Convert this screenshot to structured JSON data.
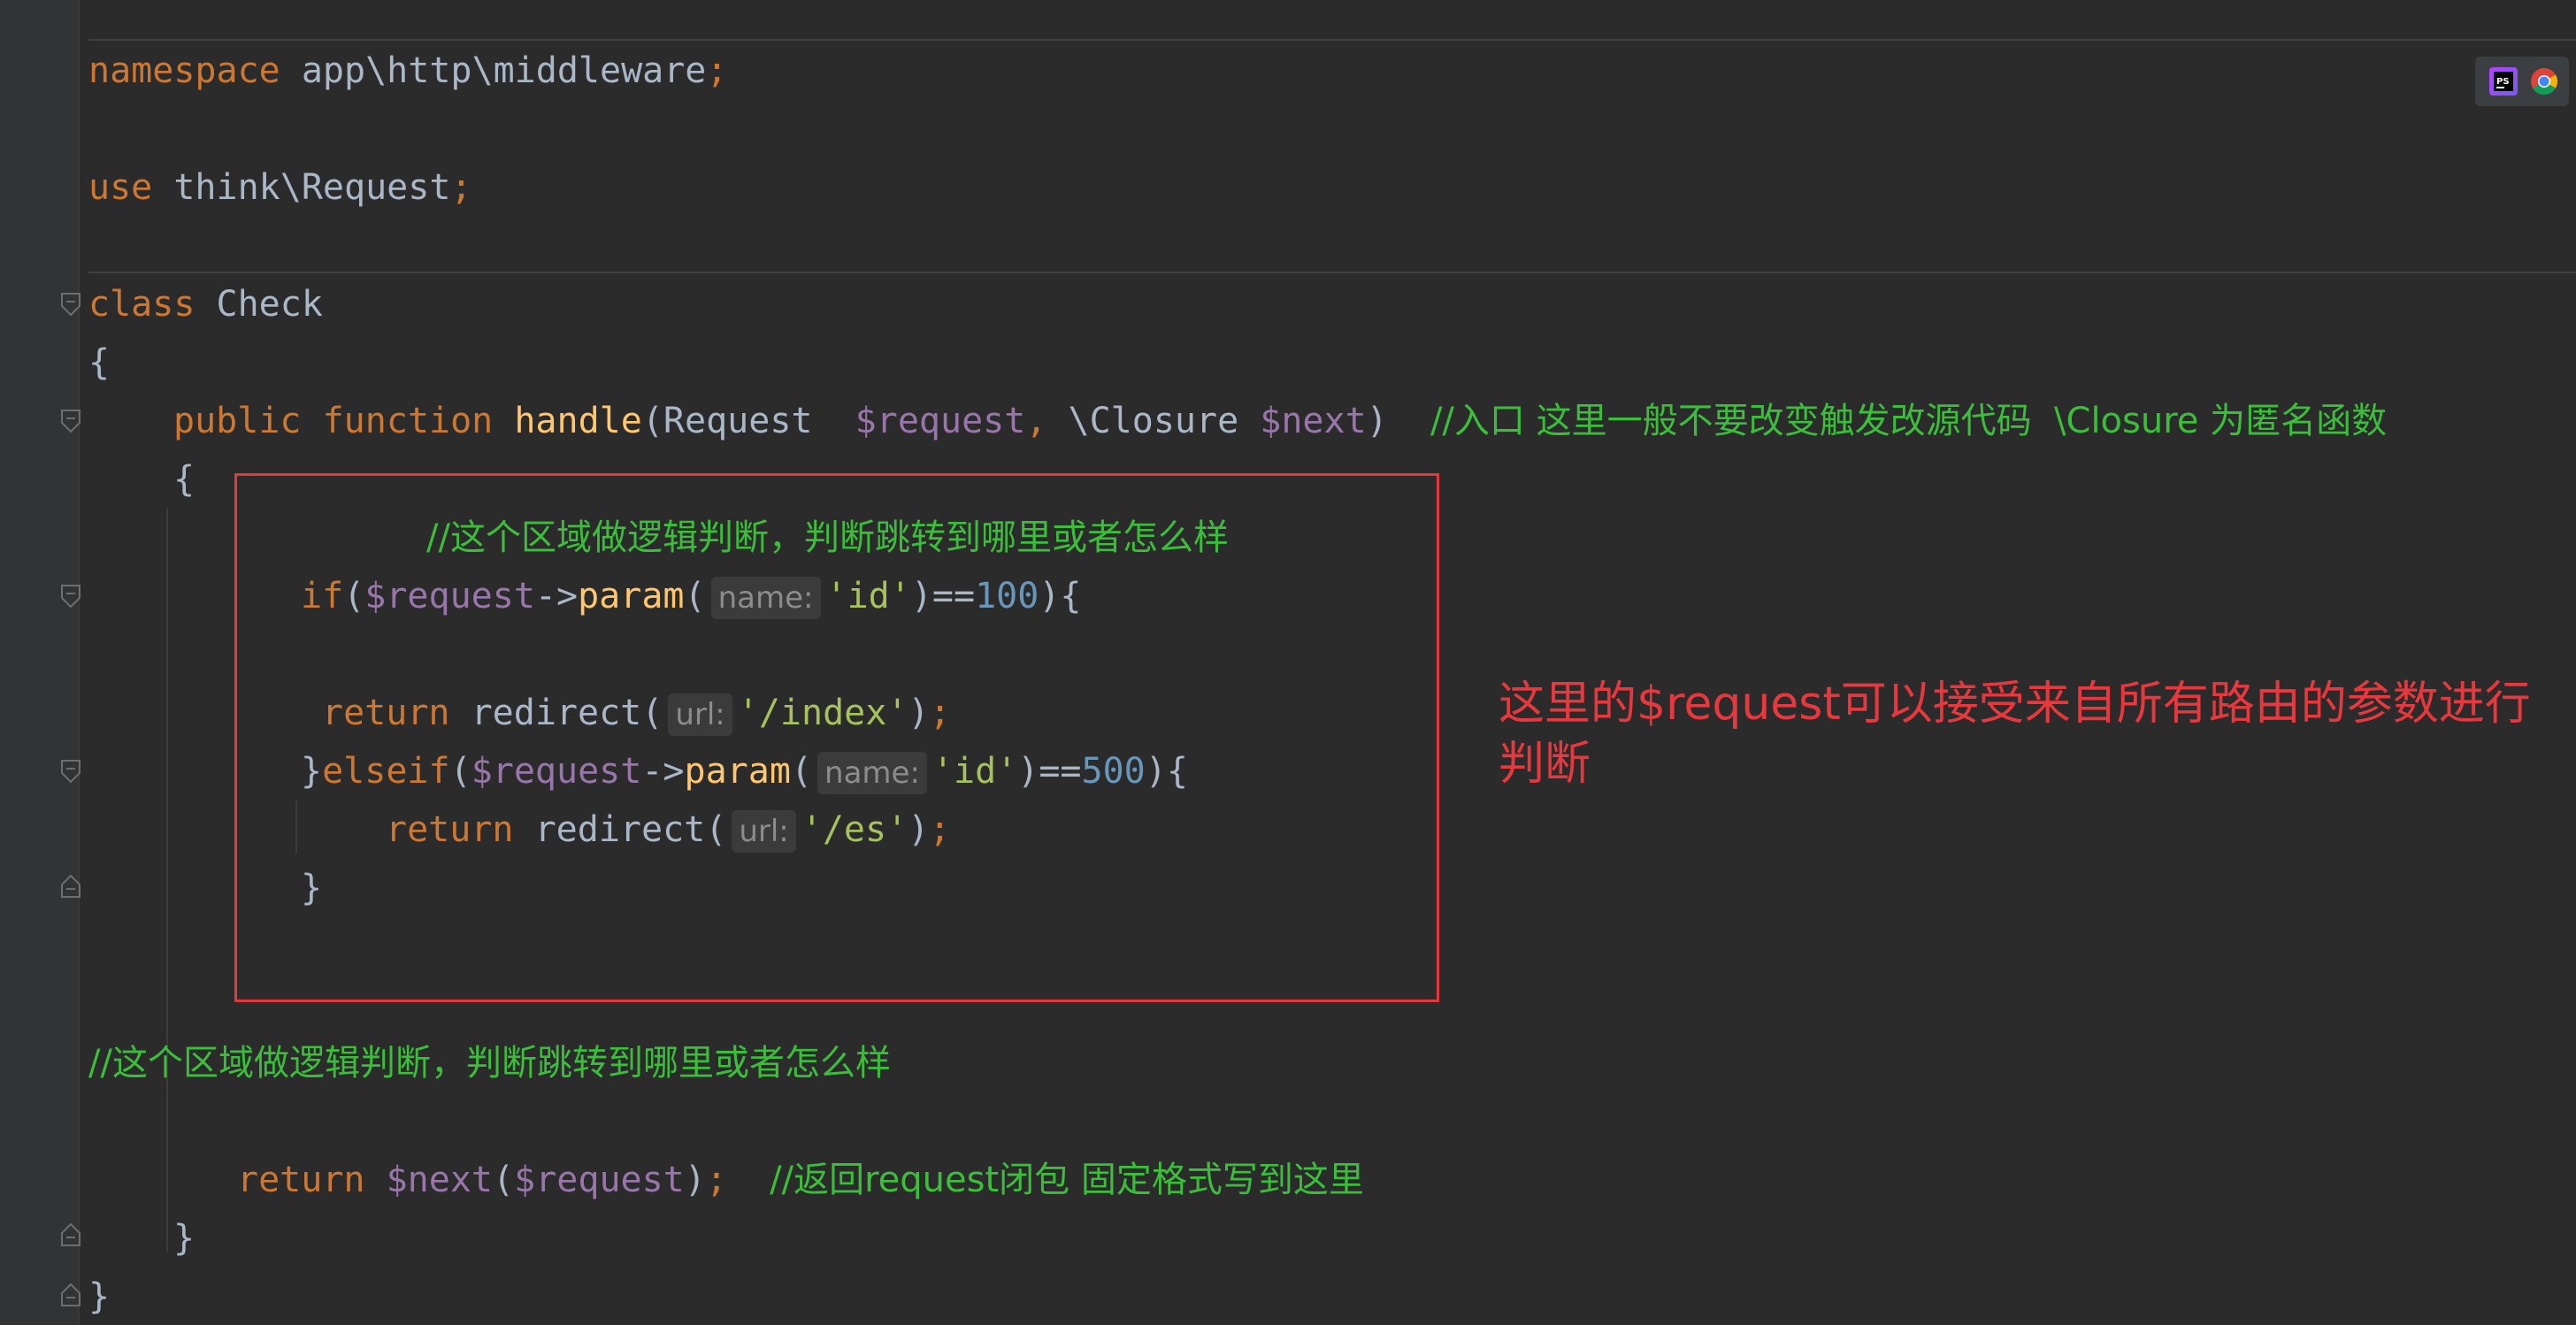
{
  "code": {
    "l1": {
      "kw_namespace": "namespace",
      "path": " app\\http\\middleware",
      "semi": ";"
    },
    "l2": {
      "kw_use": "use",
      "path": " think\\Request",
      "semi": ";"
    },
    "l3": {
      "kw_class": "class",
      "name": " Check"
    },
    "l4": {
      "brace": "{"
    },
    "l5": {
      "kw_public": "public",
      "kw_function": "function",
      "fn": "handle",
      "p1": "(Request  ",
      "v_request": "$request",
      "comma": ",",
      "p2": " \\Closure ",
      "v_next": "$next",
      "p3": ")",
      "comment": "//入口 这里一般不要改变触发改源代码  \\Closure 为匿名函数"
    },
    "l6": {
      "brace": "{"
    },
    "l7": {
      "comment": "//这个区域做逻辑判断，判断跳转到哪里或者怎么样"
    },
    "l8": {
      "kw_if": "if",
      "p1": "(",
      "v_request": "$request",
      "arrow": "->",
      "fn": "param",
      "p2": "(",
      "hint": "name:",
      "str": "'id'",
      "p3": ")==",
      "num": "100",
      "p4": "){"
    },
    "l9": {
      "kw_return": "return",
      "call": " redirect(",
      "hint": "url:",
      "str": "'/index'",
      "p": ")",
      "semi": ";"
    },
    "l10": {
      "p0": "}",
      "kw_elseif": "elseif",
      "p1": "(",
      "v_request": "$request",
      "arrow": "->",
      "fn": "param",
      "p2": "(",
      "hint": "name:",
      "str": "'id'",
      "p3": ")==",
      "num": "500",
      "p4": "){"
    },
    "l11": {
      "kw_return": "return",
      "call": " redirect(",
      "hint": "url:",
      "str": "'/es'",
      "p": ")",
      "semi": ";"
    },
    "l12": {
      "brace": "}"
    },
    "l13": {
      "comment": "//这个区域做逻辑判断，判断跳转到哪里或者怎么样"
    },
    "l14": {
      "kw_return": "return",
      "v_next": "$next",
      "p1": "(",
      "v_request": "$request",
      "p2": ")",
      "semi": ";",
      "comment": "//返回request闭包 固定格式写到这里"
    },
    "l15": {
      "brace": "}"
    },
    "l16": {
      "brace": "}"
    }
  },
  "annotation": {
    "line1": "这里的$request可以接受来自所有路由的参数进行",
    "line2": "判断"
  },
  "toolbar_icons": [
    "phpstorm-icon",
    "chrome-icon"
  ],
  "colors": {
    "background": "#2b2b2b",
    "keyword": "#cc7832",
    "function": "#ffc66d",
    "variable": "#9876aa",
    "string": "#a5c25c",
    "number": "#6897bb",
    "comment": "#3bbf3b",
    "annotation": "#e8383d"
  }
}
